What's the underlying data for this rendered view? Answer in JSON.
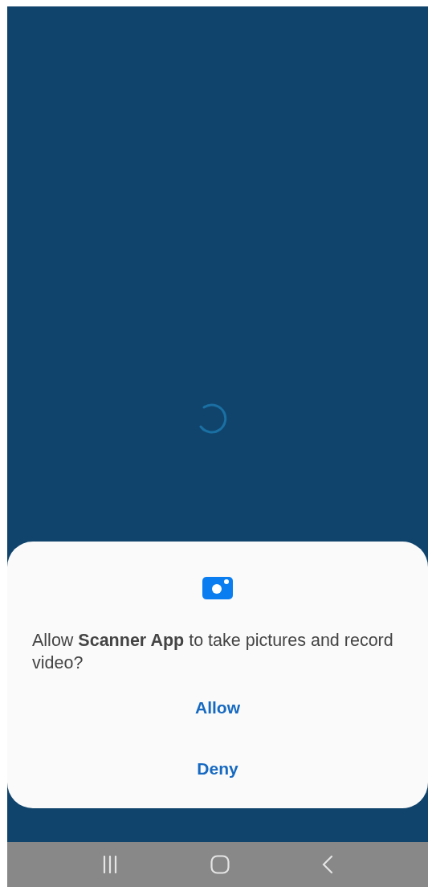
{
  "dialog": {
    "message": "Allow **Scanner App** to take pictures and record video?",
    "buttons": [
      {
        "label": "Allow"
      },
      {
        "label": "Deny"
      }
    ]
  }
}
